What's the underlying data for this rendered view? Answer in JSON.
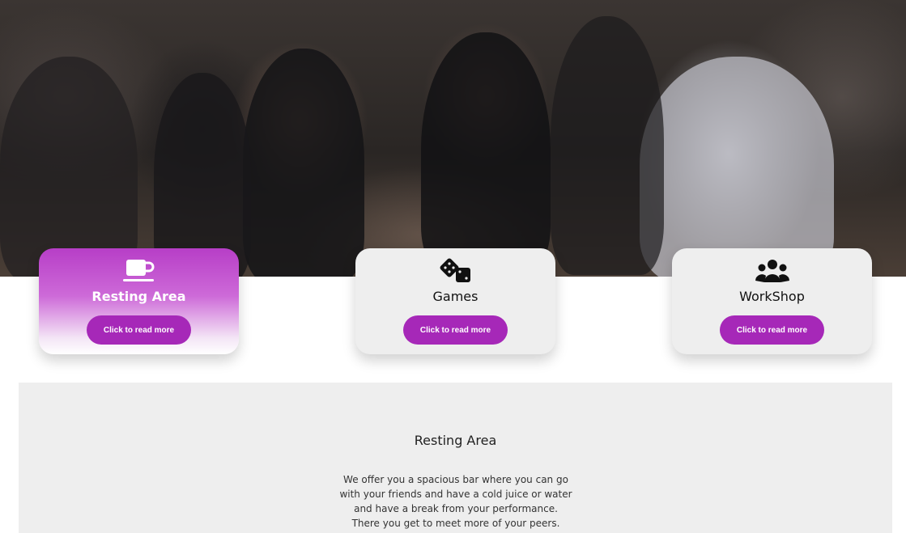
{
  "hero": {
    "image": "dancing-kids-photo"
  },
  "cards": [
    {
      "icon": "coffee-cup-icon",
      "title": "Resting Area",
      "button_label": "Click to read more",
      "active": true
    },
    {
      "icon": "dice-icon",
      "title": "Games",
      "button_label": "Click to read more",
      "active": false
    },
    {
      "icon": "users-group-icon",
      "title": "WorkShop",
      "button_label": "Click to read more",
      "active": false
    }
  ],
  "panel": {
    "title": "Resting Area",
    "lines": [
      "We offer you a spacious bar where you can go",
      "with your friends and have a cold juice or water",
      "and have a break from your performance.",
      "There you get to meet more of your peers."
    ]
  },
  "colors": {
    "accent": "#a628b8",
    "active_card_top": "#b73ec7",
    "card_bg": "#eeeeee",
    "panel_bg": "#eeeeee"
  }
}
